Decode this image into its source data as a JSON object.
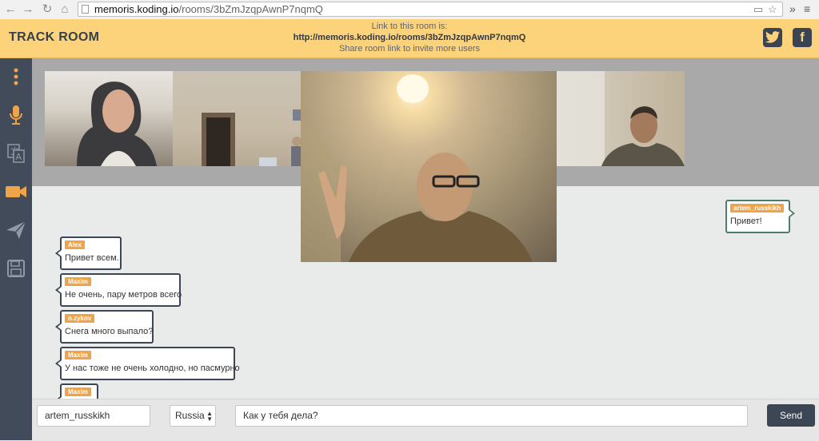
{
  "browser": {
    "url_host": "memoris.koding.io",
    "url_path": "/rooms/3bZmJzqpAwnP7nqmQ"
  },
  "header": {
    "title": "TRACK ROOM",
    "link_caption": "Link to this room is:",
    "room_link": "http://memoris.koding.io/rooms/3bZmJzqpAwnP7nqmQ",
    "share_caption": "Share room link to invite more users",
    "social": [
      "twitter-icon",
      "facebook-icon"
    ]
  },
  "sidebar": {
    "items": [
      "menu-icon",
      "microphone-icon",
      "translate-icon",
      "video-camera-icon",
      "send-icon",
      "save-icon"
    ],
    "active": "video-camera-icon",
    "accent_color": "#f0a44a"
  },
  "videos": [
    "participant-1",
    "participant-2",
    "participant-main",
    "participant-4"
  ],
  "messages": [
    {
      "user": "Alex",
      "text": "Привет всем."
    },
    {
      "user": "Maxim",
      "text": "Не очень, пару метров всего"
    },
    {
      "user": "n.zykov",
      "text": "Снега много выпало?"
    },
    {
      "user": "Maxim",
      "text": "У нас тоже не очень холодно, но пасмурно"
    },
    {
      "user": "Maxim",
      "text": ""
    }
  ],
  "own_message": {
    "user": "artem_russkikh",
    "text": "Привет!"
  },
  "composer": {
    "username": "artem_russkikh",
    "language": "Russia",
    "message": "Как у тебя дела?",
    "send_label": "Send"
  },
  "colors": {
    "header_bg": "#fcd27a",
    "sidebar_bg": "#414b5a",
    "username_tag": "#f0a44a"
  }
}
